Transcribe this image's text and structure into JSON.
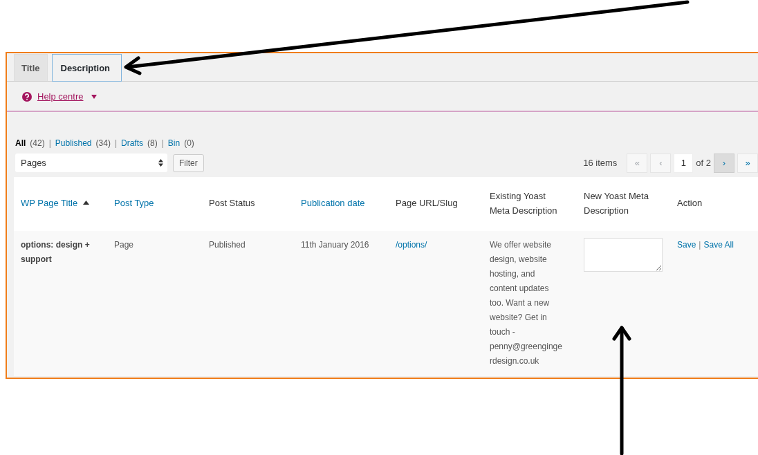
{
  "tabs": [
    {
      "label": "Title",
      "selected": false
    },
    {
      "label": "Description",
      "selected": true
    }
  ],
  "help": {
    "label": "Help centre"
  },
  "views": [
    {
      "label": "All",
      "count": "(42)",
      "selected": true,
      "separator": "|"
    },
    {
      "label": "Published",
      "count": "(34)",
      "selected": false,
      "separator": "|"
    },
    {
      "label": "Drafts",
      "count": "(8)",
      "selected": false,
      "separator": "|"
    },
    {
      "label": "Bin",
      "count": "(0)",
      "selected": false
    }
  ],
  "post_type_select": {
    "value": "Pages"
  },
  "filter_button": "Filter",
  "pagination": {
    "items": "16 items",
    "page": "1",
    "of": "of 2",
    "buttons_before": [
      {
        "label": "«",
        "disabled": true
      },
      {
        "label": "‹",
        "disabled": true
      }
    ],
    "buttons_after": [
      {
        "label": "›",
        "disabled": false,
        "hovered": true
      },
      {
        "label": "»",
        "disabled": false,
        "hovered": false
      }
    ]
  },
  "table": {
    "columns": [
      {
        "label": "WP Page Title",
        "sortable": true,
        "sorted": true
      },
      {
        "label": "Post Type",
        "sortable": true,
        "sorted": false
      },
      {
        "label": "Post Status",
        "sortable": false
      },
      {
        "label": "Publication date",
        "sortable": true,
        "sorted": false
      },
      {
        "label": "Page URL/Slug",
        "sortable": false
      },
      {
        "label": "Existing Yoast Meta Description",
        "sortable": false
      },
      {
        "label": "New Yoast Meta Description",
        "sortable": false
      },
      {
        "label": "Action",
        "sortable": false
      }
    ],
    "rows": [
      {
        "title": "options: design + support",
        "post_type": "Page",
        "post_status": "Published",
        "publication_date": "11th January 2016",
        "slug": "/options/",
        "existing_description": "We offer website design, website hosting, and content updates too. Want a new website? Get in touch - penny@greengingerdesign.co.uk",
        "actions": [
          {
            "kind": "link",
            "label": "Save"
          },
          {
            "kind": "separator",
            "label": "|"
          },
          {
            "kind": "link",
            "label": "Save All"
          }
        ]
      }
    ]
  }
}
